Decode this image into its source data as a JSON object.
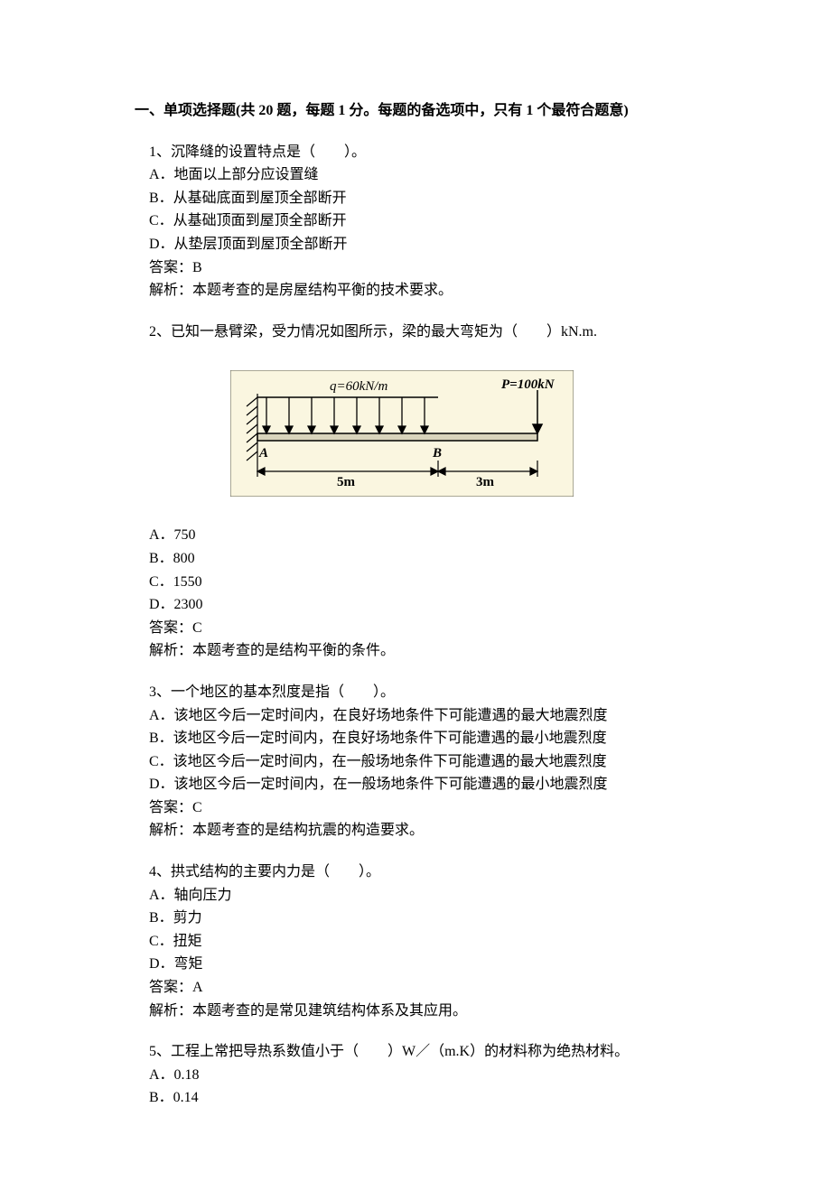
{
  "section_title": "一、单项选择题(共 20 题，每题 1 分。每题的备选项中，只有 1 个最符合题意)",
  "q1": {
    "stem": "1、沉降缝的设置特点是（　　）。",
    "a": "A．地面以上部分应设置缝",
    "b": "B．从基础底面到屋顶全部断开",
    "c": "C．从基础顶面到屋顶全部断开",
    "d": "D．从垫层顶面到屋顶全部断开",
    "answer": "答案：B",
    "analysis": "解析：本题考查的是房屋结构平衡的技术要求。"
  },
  "q2": {
    "stem": "2、已知一悬臂梁，受力情况如图所示，梁的最大弯矩为（　　）kN.m.",
    "a": "A．750",
    "b": "B．800",
    "c": "C．1550",
    "d": "D．2300",
    "answer": "答案：C",
    "analysis": "解析：本题考查的是结构平衡的条件。"
  },
  "q3": {
    "stem": "3、一个地区的基本烈度是指（　　）。",
    "a": "A．该地区今后一定时间内，在良好场地条件下可能遭遇的最大地震烈度",
    "b": "B．该地区今后一定时间内，在良好场地条件下可能遭遇的最小地震烈度",
    "c": "C．该地区今后一定时间内，在一般场地条件下可能遭遇的最大地震烈度",
    "d": "D．该地区今后一定时间内，在一般场地条件下可能遭遇的最小地震烈度",
    "answer": "答案：C",
    "analysis": "解析：本题考查的是结构抗震的构造要求。"
  },
  "q4": {
    "stem": "4、拱式结构的主要内力是（　　）。",
    "a": "A．轴向压力",
    "b": "B．剪力",
    "c": "C．扭矩",
    "d": "D．弯矩",
    "answer": "答案：A",
    "analysis": "解析：本题考查的是常见建筑结构体系及其应用。"
  },
  "q5": {
    "stem": "5、工程上常把导热系数值小于（　　）W／（m.K）的材料称为绝热材料。",
    "a": "A．0.18",
    "b": "B．0.14"
  },
  "chart_data": {
    "type": "diagram",
    "description": "Cantilever beam fixed at left end A (hatched wall). Distributed load q=60kN/m over AB (5m). Point load P=100kN at free right end. Distance B to right end is 3m.",
    "labels": {
      "q": "q=60kN/m",
      "P": "P=100kN",
      "A": "A",
      "B": "B",
      "span_AB": "5m",
      "span_B_end": "3m"
    },
    "values": {
      "q_kN_per_m": 60,
      "P_kN": 100,
      "length_AB_m": 5,
      "length_B_end_m": 3
    }
  }
}
